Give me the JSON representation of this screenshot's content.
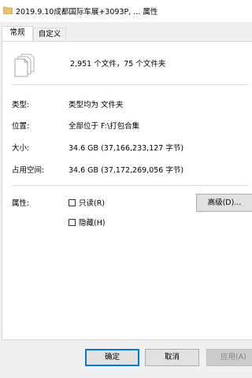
{
  "window": {
    "title": "2019.9.10成都国际车展+3093P, ... 属性"
  },
  "tabs": [
    {
      "label": "常规",
      "active": true
    },
    {
      "label": "自定义",
      "active": false
    }
  ],
  "general": {
    "summary": "2,951 个文件，75 个文件夹",
    "rows": [
      {
        "label": "类型:",
        "value": "类型均为 文件夹"
      },
      {
        "label": "位置:",
        "value": "全部位于 F:\\打包合集"
      },
      {
        "label": "大小:",
        "value": "34.6 GB (37,166,233,127 字节)"
      },
      {
        "label": "占用空间:",
        "value": "34.6 GB (37,172,269,056 字节)"
      }
    ],
    "attributes": {
      "label": "属性:",
      "readonly_label": "只读(R)",
      "readonly_checked": false,
      "hidden_label": "隐藏(H)",
      "hidden_checked": false,
      "advanced_label": "高级(D)..."
    }
  },
  "footer": {
    "ok_label": "确定",
    "cancel_label": "取消",
    "apply_label": "应用(A)",
    "apply_enabled": false
  },
  "icons": {
    "window": "folder-icon",
    "files": "multiple-files-icon"
  }
}
